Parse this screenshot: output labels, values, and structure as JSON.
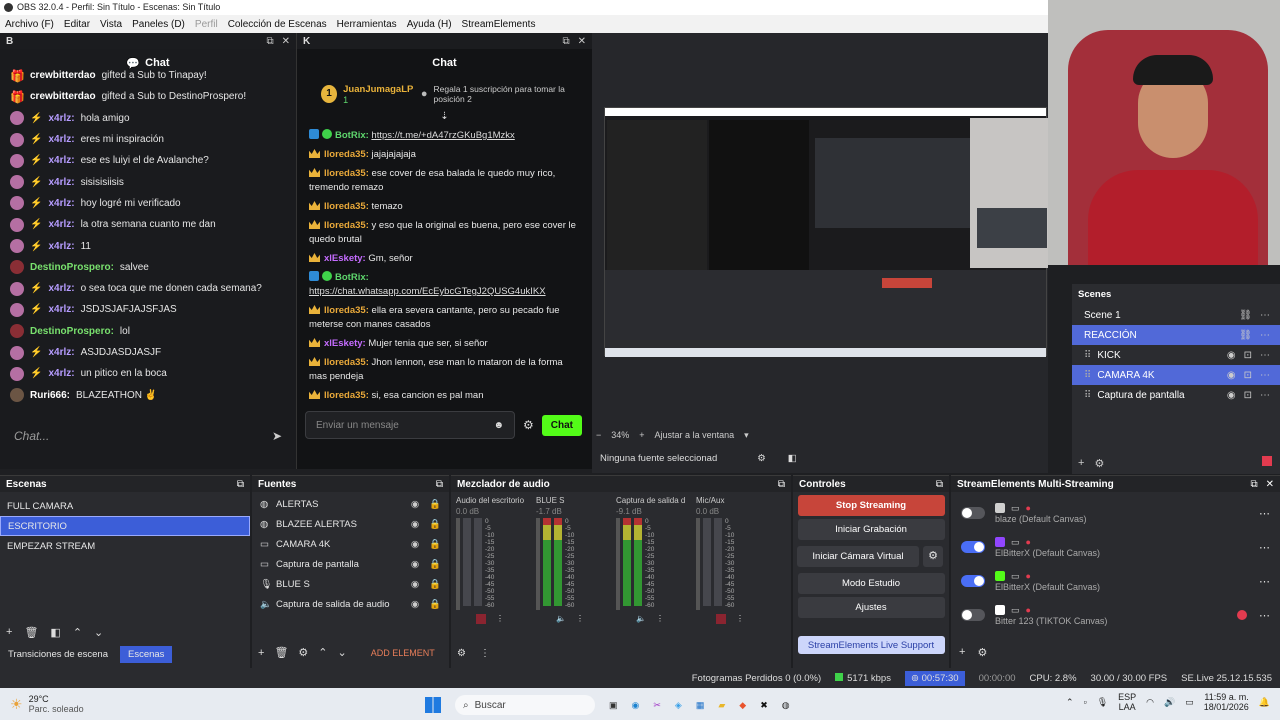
{
  "title_bar": "OBS 32.0.4 - Perfil: Sin Título - Escenas: Sin Título",
  "menu": [
    "Archivo (F)",
    "Editar",
    "Vista",
    "Paneles (D)",
    "Perfil",
    "Colección de Escenas",
    "Herramientas",
    "Ayuda (H)",
    "StreamElements"
  ],
  "chat_b": {
    "dock_label": "B",
    "title": "Chat",
    "messages": [
      {
        "user": "crewbitterdao",
        "text": "gifted a Sub to Tinapay!",
        "kind": "gift"
      },
      {
        "user": "crewbitterdao",
        "text": "gifted a Sub to DestinoProspero!",
        "kind": "gift"
      },
      {
        "user": "x4rlz:",
        "text": "hola amigo",
        "kind": "x"
      },
      {
        "user": "x4rlz:",
        "text": "eres mi inspiración",
        "kind": "x"
      },
      {
        "user": "x4rlz:",
        "text": "ese es luiyi el de Avalanche?",
        "kind": "x"
      },
      {
        "user": "x4rlz:",
        "text": "sisisisiisis",
        "kind": "x"
      },
      {
        "user": "x4rlz:",
        "text": "hoy logré mi verificado",
        "kind": "x"
      },
      {
        "user": "x4rlz:",
        "text": "la otra semana cuanto me dan",
        "kind": "x"
      },
      {
        "user": "x4rlz:",
        "text": "11",
        "kind": "x"
      },
      {
        "user": "DestinoProspero:",
        "text": "salvee",
        "kind": "d"
      },
      {
        "user": "x4rlz:",
        "text": "o sea toca que me donen cada semana?",
        "kind": "x"
      },
      {
        "user": "x4rlz:",
        "text": "JSDJSJAFJAJSFJAS",
        "kind": "x"
      },
      {
        "user": "DestinoProspero:",
        "text": "lol",
        "kind": "d"
      },
      {
        "user": "x4rlz:",
        "text": "ASJDJASDJASJF",
        "kind": "x"
      },
      {
        "user": "x4rlz:",
        "text": "un pitico en la boca",
        "kind": "x"
      },
      {
        "user": "Ruri666:",
        "text": "BLAZEATHON ✌",
        "kind": "r"
      }
    ],
    "input_placeholder": "Chat..."
  },
  "chat_k": {
    "dock_label": "K",
    "title": "Chat",
    "pinned_user": "JuanJumagaLP",
    "pinned_count": "1",
    "pinned_text": "Regala 1 suscripción para tomar la posición 2",
    "messages": [
      {
        "user": "BotRix:",
        "text": "https://t.me/+dA47rzGKuBg1Mzkx",
        "link": true,
        "style": "u3"
      },
      {
        "user": "lloreda35:",
        "text": "jajajajajaja",
        "style": "u"
      },
      {
        "user": "lloreda35:",
        "text": "ese cover de esa balada le quedo muy rico, tremendo remazo",
        "style": "u"
      },
      {
        "user": "lloreda35:",
        "text": "temazo",
        "style": "u"
      },
      {
        "user": "lloreda35:",
        "text": "y eso que la original es buena, pero ese cover le quedo brutal",
        "style": "u"
      },
      {
        "user": "xlEskety:",
        "text": "Gm, señor",
        "style": "u2"
      },
      {
        "user": "BotRix:",
        "text": "https://chat.whatsapp.com/EcEybcGTegJ2QUSG4ukIKX",
        "link": true,
        "style": "u3"
      },
      {
        "user": "lloreda35:",
        "text": "ella era severa cantante, pero su pecado fue meterse con manes casados",
        "style": "u"
      },
      {
        "user": "xlEskety:",
        "text": "Mujer tenia que ser, si señor",
        "style": "u2"
      },
      {
        "user": "lloreda35:",
        "text": "Jhon lennon, ese man lo mataron de la forma mas pendeja",
        "style": "u"
      },
      {
        "user": "lloreda35:",
        "text": "si, esa cancion es pal man",
        "style": "u"
      }
    ],
    "input_placeholder": "Enviar un mensaje",
    "send_label": "Chat"
  },
  "preview": {
    "zoom": "34%",
    "fit_label": "Ajustar a la ventana",
    "no_source": "Ninguna fuente seleccionad"
  },
  "scenes_right": {
    "title": "Scenes",
    "items": [
      {
        "label": "Scene 1",
        "selected": false,
        "indent": false
      },
      {
        "label": "REACCIÓN",
        "selected": true,
        "indent": false
      },
      {
        "label": "KICK",
        "selected": false,
        "indent": true
      },
      {
        "label": "CAMARA 4K",
        "selected": true,
        "indent": true
      },
      {
        "label": "Captura de pantalla",
        "selected": false,
        "indent": true
      }
    ]
  },
  "escenas": {
    "title": "Escenas",
    "items": [
      "FULL CAMARA",
      "ESCRITORIO",
      "EMPEZAR STREAM"
    ],
    "selected_index": 1,
    "tabs": [
      "Transiciones de escena",
      "Escenas"
    ]
  },
  "fuentes": {
    "title": "Fuentes",
    "items": [
      "ALERTAS",
      "BLAZEE ALERTAS",
      "CAMARA 4K",
      "Captura de pantalla",
      "BLUE S",
      "Captura de salida de audio"
    ],
    "add_element": "ADD ELEMENT"
  },
  "mixer": {
    "title": "Mezclador de audio",
    "channels": [
      {
        "name": "Audio del escritorio",
        "db": "0.0 dB",
        "level": 0.0
      },
      {
        "name": "BLUE S",
        "db": "-1.7 dB",
        "level": 0.7
      },
      {
        "name": "Captura de salida d",
        "db": "-9.1 dB",
        "level": 0.5
      },
      {
        "name": "Mic/Aux",
        "db": "0.0 dB",
        "level": 0.0
      }
    ],
    "scale": [
      "0",
      "-5",
      "-10",
      "-15",
      "-20",
      "-25",
      "-30",
      "-35",
      "-40",
      "-45",
      "-50",
      "-55",
      "-60"
    ]
  },
  "controles": {
    "title": "Controles",
    "stop_streaming": "Stop Streaming",
    "start_recording": "Iniciar Grabación",
    "virtual_camera": "Iniciar Cámara Virtual",
    "studio_mode": "Modo Estudio",
    "settings": "Ajustes",
    "support": "StreamElements Live Support"
  },
  "multistream": {
    "title": "StreamElements Multi-Streaming",
    "targets": [
      {
        "label": "blaze (Default Canvas)",
        "on": false,
        "platform_color": "#cfcfcf"
      },
      {
        "label": "ElBitterX (Default Canvas)",
        "on": true,
        "platform_color": "#9146ff"
      },
      {
        "label": "ElBitterX (Default Canvas)",
        "on": true,
        "platform_color": "#53fc18"
      },
      {
        "label": "Bitter 123 (TIKTOK Canvas)",
        "on": false,
        "platform_color": "#ffffff"
      }
    ]
  },
  "status": {
    "dropped": "Fotogramas Perdidos 0 (0.0%)",
    "kbps": "5171 kbps",
    "stream_time": "00:57:30",
    "rec_time": "00:00:00",
    "cpu": "CPU: 2.8%",
    "fps": "30.00 / 30.00 FPS",
    "version": "SE.Live 25.12.15.535"
  },
  "taskbar": {
    "temp": "29°C",
    "weather": "Parc. soleado",
    "search": "Buscar",
    "lang": "ESP",
    "lang2": "LAA",
    "time": "11:59 a. m.",
    "date": "18/01/2026"
  },
  "colors": {
    "accent": "#3c5ed8",
    "stop": "#c7453a",
    "kick": "#53fc18"
  }
}
